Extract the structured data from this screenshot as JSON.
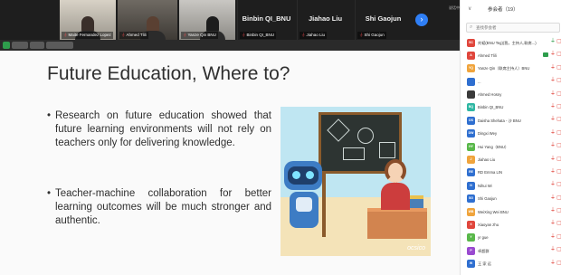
{
  "video_strip": {
    "tiles": [
      {
        "label": "Maite Fernandez Lopez",
        "mic_muted": true
      },
      {
        "label": "Ahmed Tlili",
        "mic_muted": true
      },
      {
        "label": "Yanze Qin BNU",
        "mic_muted": true
      }
    ],
    "name_tiles": [
      "Binbin QI_BNU",
      "Jiahao Liu",
      "Shi Gaojun"
    ],
    "next_glyph": "›",
    "speaker_indicator": "说话中"
  },
  "slide": {
    "title": "Future Education, Where to?",
    "bullets": [
      "Research on future education showed that future learning environments will not rely on teachers only for delivering knowledge.",
      "Teacher-machine collaboration for better learning outcomes will be much stronger and authentic."
    ],
    "image_logo": "ocsico"
  },
  "panel": {
    "title": "参会者（19）",
    "collapse_glyph": "∨",
    "search_placeholder": "查找参会者",
    "participants": [
      {
        "initials": "SC",
        "color": "#e0463c",
        "name": "刘韬(BNU Teg)(我，主持人,联席...)",
        "mic": "on"
      },
      {
        "initials": "A",
        "color": "#e0463c",
        "name": "Ahmed Tlili",
        "mic": "muted",
        "camera": true
      },
      {
        "initials": "YQ",
        "color": "#f0a43c",
        "name": "Yanze Qin（联席主持人）BNU",
        "mic": "muted"
      },
      {
        "initials": "",
        "color": "#2f6fd0",
        "name": "...",
        "mic": "muted"
      },
      {
        "initials": "",
        "color": "#3a3a3a",
        "name": "Ahmed Hosny",
        "mic": "muted"
      },
      {
        "initials": "BQ",
        "color": "#2fb7a3",
        "name": "Binbin QI_BNU",
        "mic": "muted"
      },
      {
        "initials": "DS",
        "color": "#2f6fd0",
        "name": "Daisha Shehata - 沙 BNU",
        "mic": "muted"
      },
      {
        "initials": "DW",
        "color": "#2f6fd0",
        "name": "Dingxi Wey",
        "mic": "muted"
      },
      {
        "initials": "HY",
        "color": "#59b84a",
        "name": "Hui Yang（BNU）",
        "mic": "muted"
      },
      {
        "initials": "J",
        "color": "#f0a43c",
        "name": "Jiahao Liu",
        "mic": "muted"
      },
      {
        "initials": "RE",
        "color": "#2f6fd0",
        "name": "RD Emma LIN",
        "mic": "muted"
      },
      {
        "initials": "N",
        "color": "#2f6fd0",
        "name": "Nihui Wi",
        "mic": "muted"
      },
      {
        "initials": "SG",
        "color": "#2f6fd0",
        "name": "Shi Gaojun",
        "mic": "muted"
      },
      {
        "initials": "WB",
        "color": "#f0a43c",
        "name": "WeiXing Wei BNU",
        "mic": "muted"
      },
      {
        "initials": "X",
        "color": "#e0463c",
        "name": "Xiaoyan zhu",
        "mic": "muted"
      },
      {
        "initials": "Y",
        "color": "#59b84a",
        "name": "yr gue",
        "mic": "muted"
      },
      {
        "initials": "P",
        "color": "#9a4ad0",
        "name": "卓超群",
        "mic": "muted"
      },
      {
        "initials": "W",
        "color": "#2f6fd0",
        "name": "王 家 远",
        "mic": "muted"
      }
    ]
  }
}
